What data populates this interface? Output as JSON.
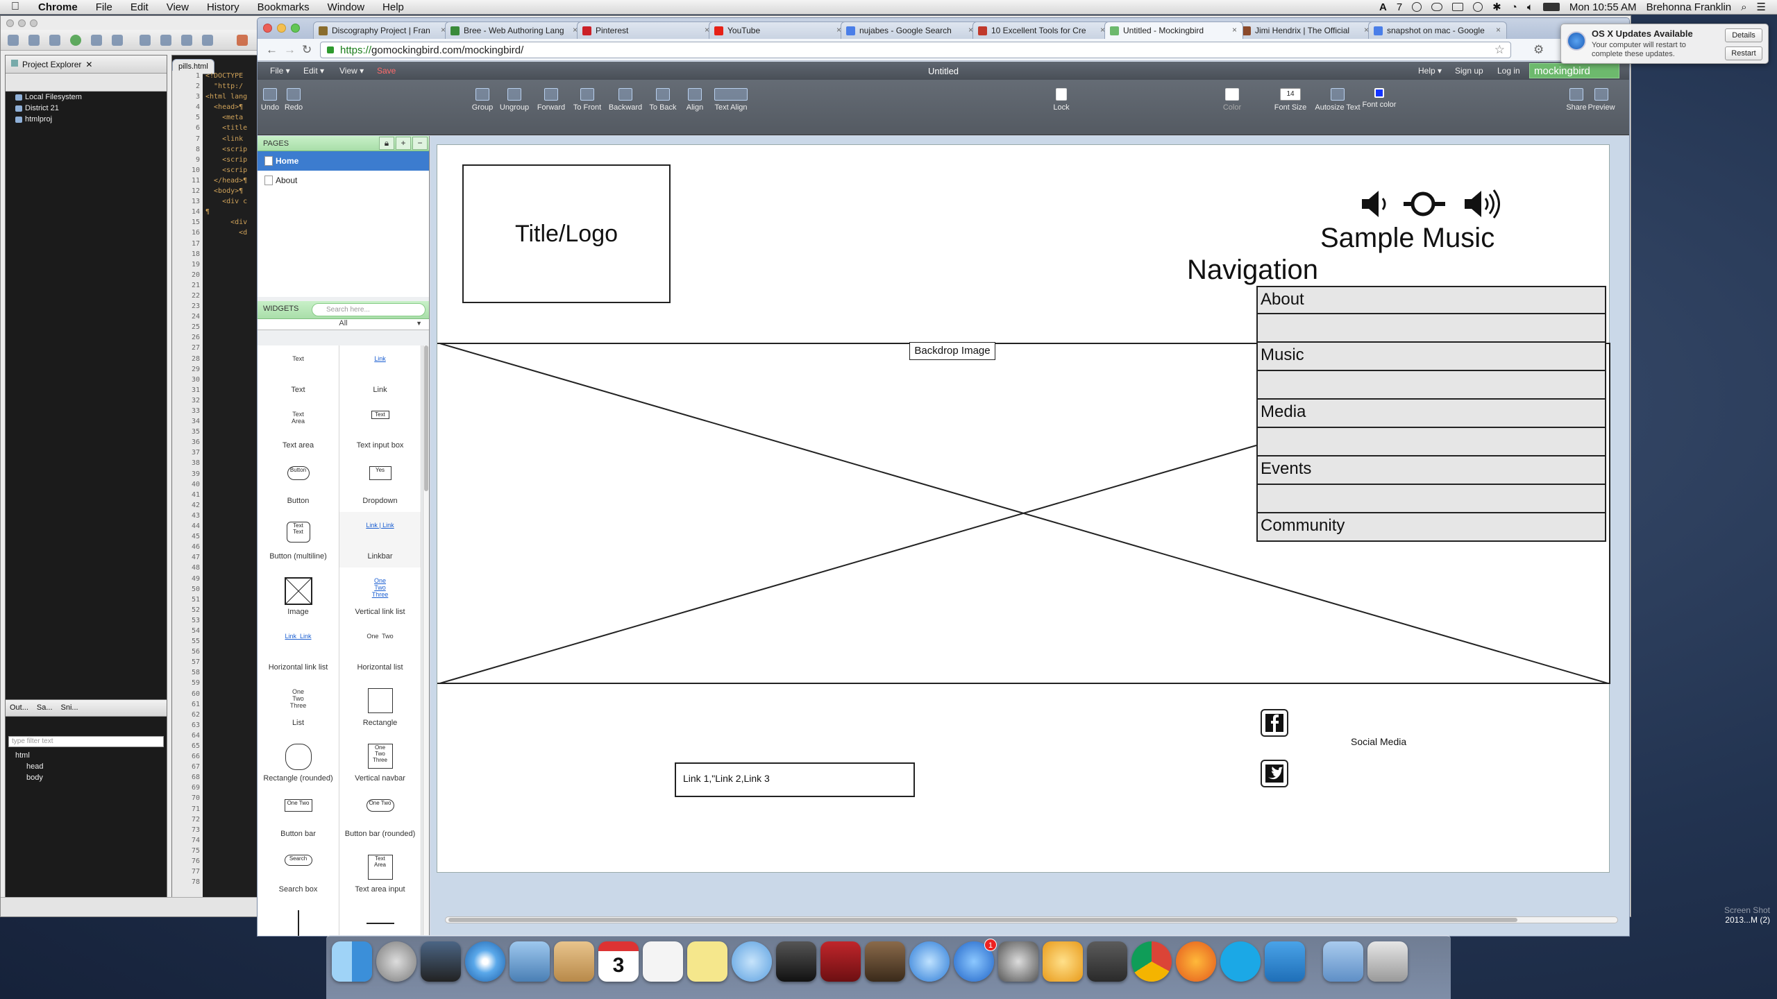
{
  "menubar": {
    "app": "Chrome",
    "items": [
      "File",
      "Edit",
      "View",
      "History",
      "Bookmarks",
      "Window",
      "Help"
    ],
    "time": "Mon 10:55 AM",
    "user": "Brehonna Franklin",
    "battery_count": "7"
  },
  "ide": {
    "file_tab": "pills.html",
    "project_explorer_title": "Project Explorer",
    "tree": [
      "Local Filesystem",
      "District 21",
      "htmlproj"
    ],
    "outline_tabs": [
      "Out...",
      "Sa...",
      "Sni..."
    ],
    "filter_placeholder": "type filter text",
    "outline_tree": [
      "html",
      "head",
      "body"
    ],
    "line_numbers": [
      "1",
      "2",
      "3",
      "4",
      "5",
      "6",
      "7",
      "8",
      "9",
      "10",
      "11",
      "12",
      "13",
      "14",
      "15",
      "16",
      "17",
      "18",
      "19",
      "20",
      "21",
      "22",
      "23",
      "24",
      "25",
      "26",
      "27",
      "28",
      "29",
      "30",
      "31",
      "32",
      "33",
      "34",
      "35",
      "36",
      "37",
      "38",
      "39",
      "40",
      "41",
      "42",
      "43",
      "44",
      "45",
      "46",
      "47",
      "48",
      "49",
      "50",
      "51",
      "52",
      "53",
      "54",
      "55",
      "56",
      "57",
      "58",
      "59",
      "60",
      "61",
      "62",
      "63",
      "64",
      "65",
      "66",
      "67",
      "68",
      "69",
      "70",
      "71",
      "72",
      "73",
      "74",
      "75",
      "76",
      "77",
      "78"
    ],
    "code_lines": [
      "<!DOCTYPE",
      "  \"http:/",
      "<html lang",
      "  <head>¶",
      "    <meta",
      "    <title",
      "    <link",
      "    <scrip",
      "    <scrip",
      "    <scrip",
      "  </head>¶",
      "  <body>¶",
      "    <div c",
      "¶",
      "      <div",
      "        <d"
    ]
  },
  "browser": {
    "tabs": [
      {
        "label": "Discography Project | Fran",
        "color": "#8a6d2e"
      },
      {
        "label": "Bree - Web Authoring Lang",
        "color": "#3a8a3a"
      },
      {
        "label": "Pinterest",
        "color": "#cb2027"
      },
      {
        "label": "YouTube",
        "color": "#e62117"
      },
      {
        "label": "nujabes - Google Search",
        "color": "#4a7ee8"
      },
      {
        "label": "10 Excellent Tools for Cre",
        "color": "#c0392b"
      },
      {
        "label": "Untitled - Mockingbird",
        "color": "#6db96d"
      },
      {
        "label": "Jimi Hendrix | The Official",
        "color": "#8b4a2b"
      },
      {
        "label": "snapshot on mac - Google",
        "color": "#4a7ee8"
      }
    ],
    "url_scheme": "https://",
    "url_rest": "gomockingbird.com/mockingbird/"
  },
  "mockingbird": {
    "menu": [
      "File ▾",
      "Edit ▾",
      "View ▾"
    ],
    "save": "Save",
    "doc_title": "Untitled",
    "right_menu": [
      "Help ▾",
      "Sign up",
      "Log in"
    ],
    "logo": "mockingbird",
    "toolbar_left": [
      "Undo",
      "Redo"
    ],
    "toolbar_arrange": [
      "Group",
      "Ungroup",
      "Forward",
      "To Front",
      "Backward",
      "To Back",
      "Align",
      "Text Align"
    ],
    "lock": "Lock",
    "color": "Color",
    "font_size_value": "14",
    "font_size": "Font Size",
    "autosize": "Autosize Text",
    "font_color": "Font color",
    "share": "Share",
    "preview": "Preview",
    "pages_header": "PAGES",
    "pages": [
      "Home",
      "About"
    ],
    "widgets_header": "WIDGETS",
    "widget_search_placeholder": "Search here...",
    "widget_filter": "All",
    "widgets": [
      [
        "Text",
        "Link"
      ],
      [
        "Text area",
        "Text input box"
      ],
      [
        "Button",
        "Dropdown"
      ],
      [
        "Button (multiline)",
        "Linkbar"
      ],
      [
        "Image",
        "Vertical link list"
      ],
      [
        "Horizontal link list",
        "Horizontal list"
      ],
      [
        "List",
        "Rectangle"
      ],
      [
        "Rectangle (rounded)",
        "Vertical navbar"
      ],
      [
        "Button bar",
        "Button bar (rounded)"
      ],
      [
        "Search box",
        "Text area input"
      ],
      [
        "Vertical line",
        "Horizontal line"
      ]
    ],
    "widget_previews": {
      "text": "Text",
      "link": "Link",
      "text_area": "Text\nArea",
      "text_input": "Text",
      "button": "Button",
      "dropdown": "Yes",
      "multiline": "Text\nText",
      "linkbar": "Link | Link",
      "vlinks": [
        "One",
        "Two",
        "Three"
      ],
      "hlinks": "Link  Link",
      "hlist": "One  Two",
      "list": [
        "One",
        "Two",
        "Three"
      ],
      "vnav": [
        "One",
        "Two",
        "Three"
      ],
      "buttonbar": "One Two",
      "search": "Search",
      "textarea_input": "Text\nArea"
    },
    "canvas": {
      "title_logo": "Title/Logo",
      "navigation": "Navigation",
      "sample_music": "Sample Music",
      "backdrop_label": "Backdrop Image",
      "nav_items": [
        "About",
        "Music",
        "Media",
        "Events",
        "Community"
      ],
      "links": "Link 1,\"Link 2,Link 3",
      "social_media": "Social Media"
    }
  },
  "notification": {
    "title": "OS X Updates Available",
    "body": "Your computer will restart to complete these updates.",
    "details": "Details",
    "restart": "Restart"
  },
  "desktop_file": {
    "line1": "Screen Shot",
    "line2": "2013...M (2)"
  },
  "dock": {
    "calendar_day": "3",
    "app_store_badge": "1"
  }
}
